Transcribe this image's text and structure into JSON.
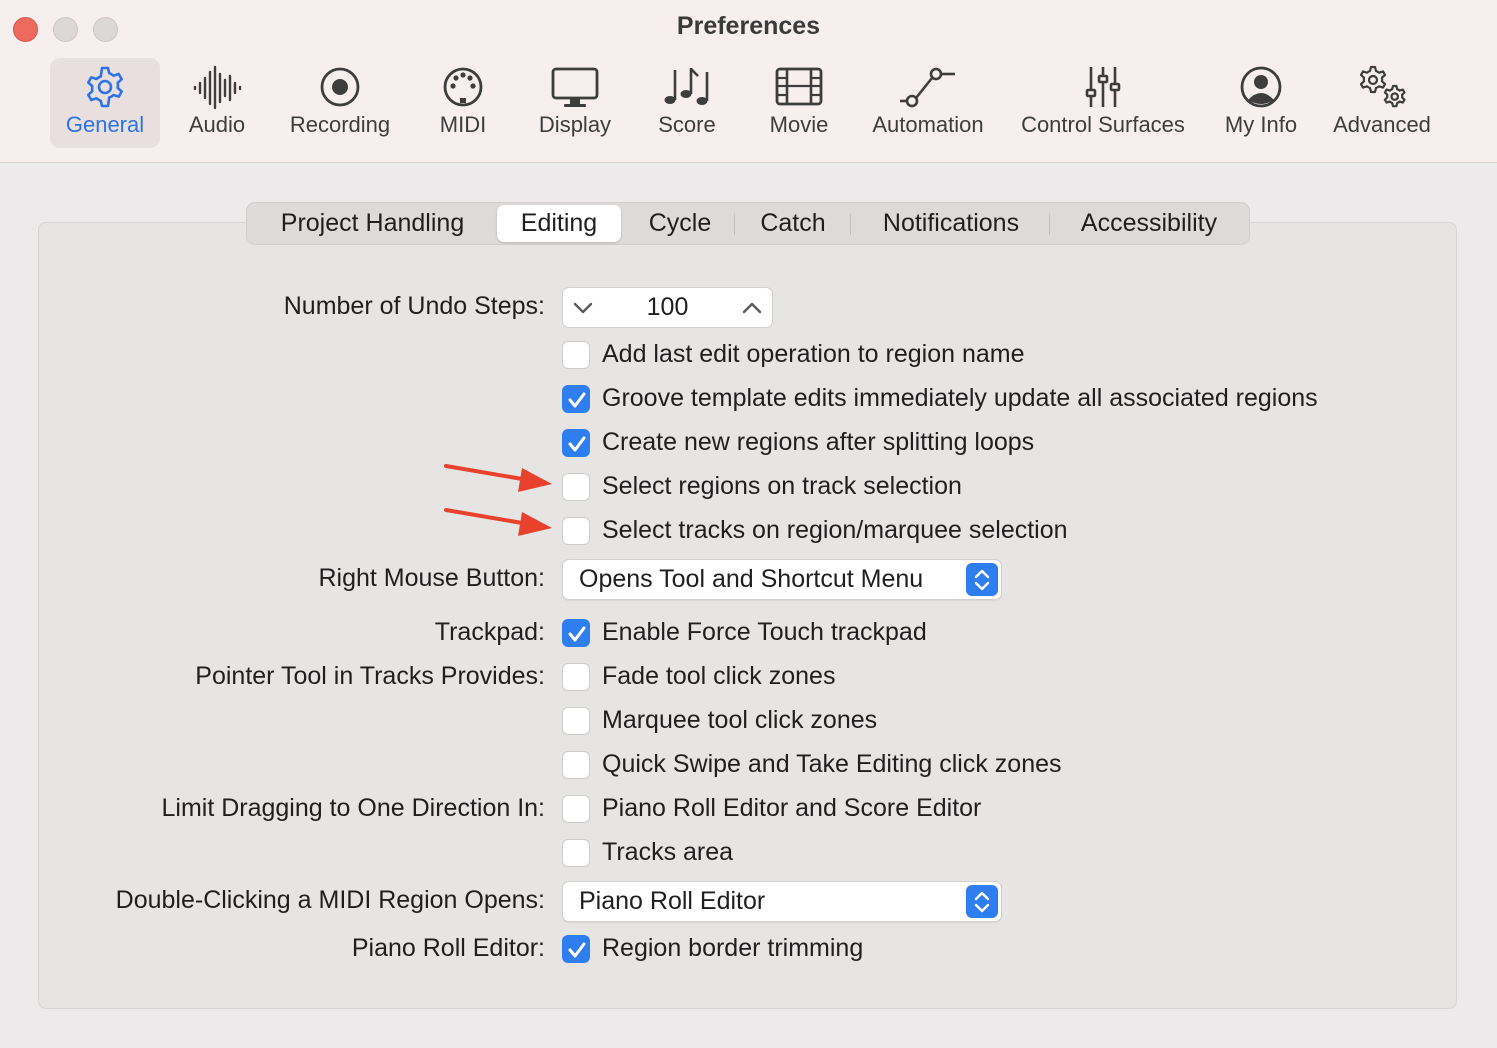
{
  "window": {
    "title": "Preferences"
  },
  "toolbar": {
    "items": [
      {
        "label": "General",
        "icon": "gear-icon",
        "active": true
      },
      {
        "label": "Audio",
        "icon": "waveform-icon"
      },
      {
        "label": "Recording",
        "icon": "record-icon"
      },
      {
        "label": "MIDI",
        "icon": "midi-port-icon"
      },
      {
        "label": "Display",
        "icon": "monitor-icon"
      },
      {
        "label": "Score",
        "icon": "music-notes-icon"
      },
      {
        "label": "Movie",
        "icon": "film-icon"
      },
      {
        "label": "Automation",
        "icon": "automation-curve-icon"
      },
      {
        "label": "Control Surfaces",
        "icon": "faders-icon"
      },
      {
        "label": "My Info",
        "icon": "person-icon"
      },
      {
        "label": "Advanced",
        "icon": "gears-icon"
      }
    ]
  },
  "tabs": [
    {
      "label": "Project Handling"
    },
    {
      "label": "Editing",
      "active": true
    },
    {
      "label": "Cycle"
    },
    {
      "label": "Catch"
    },
    {
      "label": "Notifications"
    },
    {
      "label": "Accessibility"
    }
  ],
  "settings": {
    "undo": {
      "label": "Number of Undo Steps:",
      "value": "100"
    },
    "checkboxes_top": [
      {
        "label": "Add last edit operation to region name",
        "checked": false
      },
      {
        "label": "Groove template edits immediately update all associated regions",
        "checked": true
      },
      {
        "label": "Create new regions after splitting loops",
        "checked": true
      },
      {
        "label": "Select regions on track selection",
        "checked": false
      },
      {
        "label": "Select tracks on region/marquee selection",
        "checked": false
      }
    ],
    "right_mouse": {
      "label": "Right Mouse Button:",
      "value": "Opens Tool and Shortcut Menu"
    },
    "trackpad": {
      "label": "Trackpad:",
      "option": "Enable Force Touch trackpad",
      "checked": true
    },
    "pointer_tool": {
      "label": "Pointer Tool in Tracks Provides:",
      "options": [
        {
          "label": "Fade tool click zones",
          "checked": false
        },
        {
          "label": "Marquee tool click zones",
          "checked": false
        },
        {
          "label": "Quick Swipe and Take Editing click zones",
          "checked": false
        }
      ]
    },
    "limit_dragging": {
      "label": "Limit Dragging to One Direction In:",
      "options": [
        {
          "label": "Piano Roll Editor and Score Editor",
          "checked": false
        },
        {
          "label": "Tracks area",
          "checked": false
        }
      ]
    },
    "double_click_midi": {
      "label": "Double-Clicking a MIDI Region Opens:",
      "value": "Piano Roll Editor"
    },
    "piano_roll": {
      "label": "Piano Roll Editor:",
      "option": "Region border trimming",
      "checked": true
    }
  },
  "colors": {
    "accent": "#2f7ef0",
    "annotation_arrow": "#e8412c",
    "close_button": "#ee6a5f"
  }
}
